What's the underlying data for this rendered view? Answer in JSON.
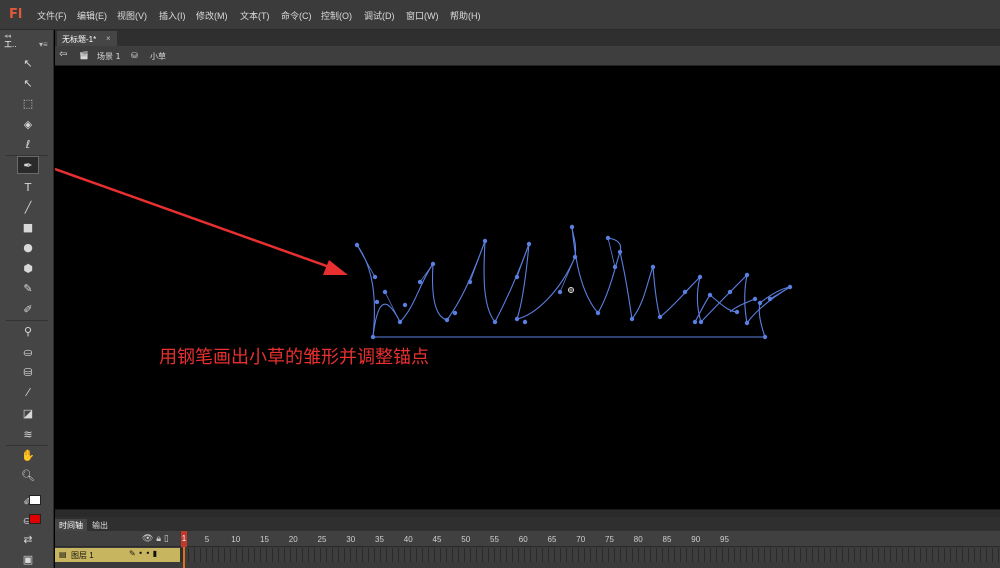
{
  "app": {
    "logo": "Fl"
  },
  "menu": [
    "文件(F)",
    "编辑(E)",
    "视图(V)",
    "插入(I)",
    "修改(M)",
    "文本(T)",
    "命令(C)",
    "控制(O)",
    "调试(D)",
    "窗口(W)",
    "帮助(H)"
  ],
  "toolbar": {
    "tab_label": "工..",
    "menu_glyph": "▾≡",
    "grip": "◂◂"
  },
  "tools": [
    {
      "name": "selection-tool-icon",
      "glyph": "↖"
    },
    {
      "name": "subselection-tool-icon",
      "glyph": "↖"
    },
    {
      "name": "free-transform-tool-icon",
      "glyph": "⬚"
    },
    {
      "name": "3d-rotation-tool-icon",
      "glyph": "◈"
    },
    {
      "name": "lasso-tool-icon",
      "glyph": "ℓ"
    },
    {
      "name": "pen-tool-icon",
      "glyph": "✒",
      "active": true
    },
    {
      "name": "text-tool-icon",
      "glyph": "T"
    },
    {
      "name": "line-tool-icon",
      "glyph": "╱"
    },
    {
      "name": "rectangle-tool-icon",
      "glyph": "■"
    },
    {
      "name": "oval-tool-icon",
      "glyph": "●"
    },
    {
      "name": "polystar-tool-icon",
      "glyph": "⬢"
    },
    {
      "name": "pencil-tool-icon",
      "glyph": "✎"
    },
    {
      "name": "brush-tool-icon",
      "glyph": "✐"
    },
    {
      "name": "bone-tool-icon",
      "glyph": "⚲"
    },
    {
      "name": "paint-bucket-tool-icon",
      "glyph": "⛀"
    },
    {
      "name": "ink-bottle-tool-icon",
      "glyph": "⛁"
    },
    {
      "name": "eyedropper-tool-icon",
      "glyph": "⁄"
    },
    {
      "name": "eraser-tool-icon",
      "glyph": "◪"
    },
    {
      "name": "width-tool-icon",
      "glyph": "≋"
    },
    {
      "name": "hand-tool-icon",
      "glyph": "✋"
    },
    {
      "name": "zoom-tool-icon",
      "glyph": "🔍︎"
    }
  ],
  "colors": {
    "stroke": "#ffffff",
    "fill": "#e00000",
    "path": "#5b7fe0",
    "accent": "#e05a3a",
    "annotation": "#e83030"
  },
  "document": {
    "tab_title": "无标题-1*",
    "close": "×"
  },
  "editbar": {
    "back": "⇦",
    "scene_icon": "🎬︎",
    "scene": "场景 1",
    "symbol_icon": "⛁",
    "symbol": "小草"
  },
  "annotation": {
    "text": "用钢笔画出小草的雏形并调整锚点"
  },
  "timeline": {
    "tabs": [
      "时间轴",
      "输出"
    ],
    "header_icons": "👁︎ 🔒︎ ▯",
    "frame_numbers": [
      1,
      5,
      10,
      15,
      20,
      25,
      30,
      35,
      40,
      45,
      50,
      55,
      60,
      65,
      70,
      75,
      80,
      85,
      90,
      95
    ],
    "current_frame": "1",
    "layer": {
      "name": "图层 1",
      "marks": "✎  •  •  ▮"
    }
  }
}
